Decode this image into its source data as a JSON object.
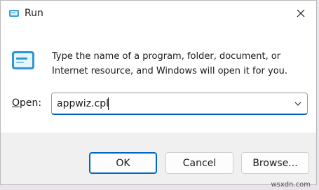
{
  "window": {
    "title": "Run",
    "close_label": "×"
  },
  "dialog": {
    "description": "Type the name of a program, folder, document, or Internet resource, and Windows will open it for you.",
    "open_label_prefix": "",
    "open_label_hotkey": "O",
    "open_label_suffix": "pen:",
    "open_value": "appwiz.cpl"
  },
  "buttons": {
    "ok": "OK",
    "cancel": "Cancel",
    "browse": "Browse..."
  },
  "watermark": "wsxdn.com",
  "icons": {
    "app": "run-app-icon",
    "big": "run-program-icon",
    "close": "close-icon",
    "dropdown": "chevron-down-icon"
  },
  "colors": {
    "accent": "#0067c0",
    "footer_bg": "#f0f0f0",
    "window_bg": "#ffffff"
  }
}
